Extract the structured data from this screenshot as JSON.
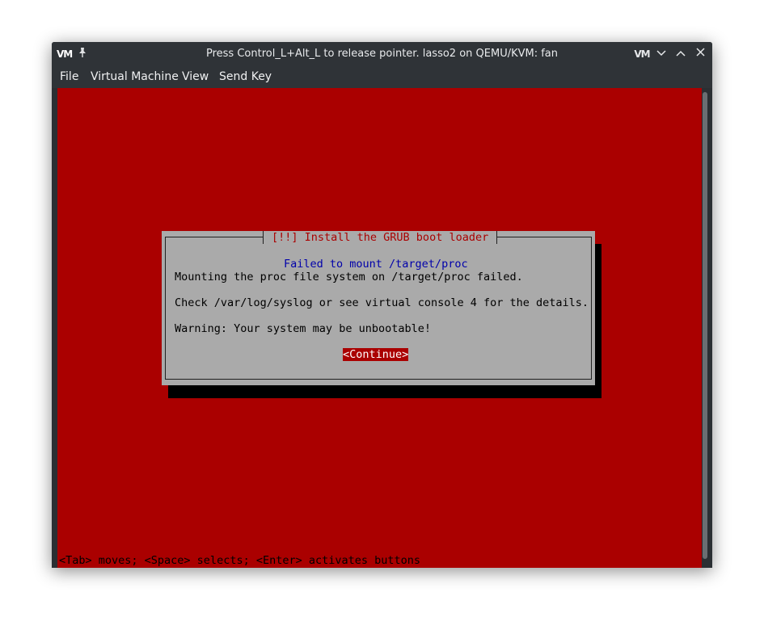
{
  "window": {
    "title": "Press Control_L+Alt_L to release pointer. lasso2 on QEMU/KVM: fan",
    "logo_text": "VM",
    "pin_glyph": "📌"
  },
  "titlebar_buttons": {
    "vm_glyph": "VM",
    "minimize_glyph": "⌄",
    "maximize_glyph": "⌃",
    "close_glyph": "✕"
  },
  "menu": {
    "file": "File",
    "virtual_machine": "Virtual Machine",
    "view": "View",
    "send_key": "Send Key"
  },
  "dialog": {
    "title": "[!!] Install the GRUB boot loader",
    "subtitle": "Failed to mount /target/proc",
    "line1": "Mounting the proc file system on /target/proc failed.",
    "line2": "Check /var/log/syslog or see virtual console 4 for the details.",
    "line3": "Warning: Your system may be unbootable!",
    "button": "<Continue>"
  },
  "footer": {
    "hint": "<Tab> moves; <Space> selects; <Enter> activates buttons"
  },
  "colors": {
    "installer_background": "#aa0000",
    "dialog_background": "#aaaaaa",
    "title_text": "#aa0000",
    "subtitle_text": "#0000aa",
    "window_chrome": "#2f3337"
  }
}
